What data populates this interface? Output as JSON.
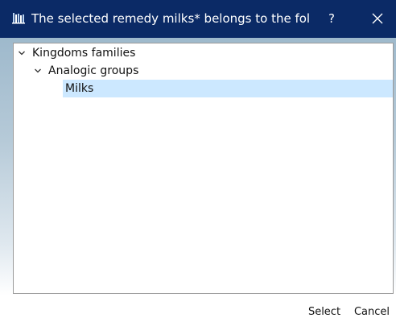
{
  "window": {
    "title": "The selected remedy milks* belongs to the followi...",
    "help_label": "?",
    "app_icon": "bookshelf-icon",
    "close_icon": "close-icon"
  },
  "tree": {
    "items": [
      {
        "label": "Kingdoms families",
        "expanded": true,
        "level": 0
      },
      {
        "label": "Analogic groups",
        "expanded": true,
        "level": 1
      },
      {
        "label": "Milks",
        "selected": true,
        "level": 2
      }
    ],
    "selection_color": "#cce8ff"
  },
  "buttons": {
    "select_label": "Select",
    "cancel_label": "Cancel"
  },
  "colors": {
    "titlebar": "#0b2a66"
  }
}
